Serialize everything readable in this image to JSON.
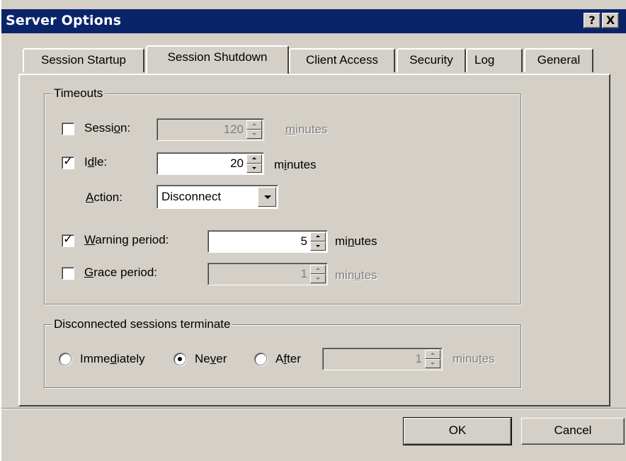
{
  "window": {
    "title": "Server Options",
    "help_label": "?",
    "close_label": "X"
  },
  "tabs": [
    {
      "label": "Session Startup"
    },
    {
      "label": "Session Shutdown",
      "active": true
    },
    {
      "label": "Client Access"
    },
    {
      "label": "Security"
    },
    {
      "label": "Log"
    },
    {
      "label": "General"
    }
  ],
  "timeouts": {
    "legend": "Timeouts",
    "session": {
      "label_pre": "Sessi",
      "label_ul": "o",
      "label_post": "n:",
      "checked": false,
      "value": "120",
      "unit_pre": "",
      "unit_ul": "m",
      "unit_post": "inutes",
      "enabled": false
    },
    "idle": {
      "label_pre": "I",
      "label_ul": "d",
      "label_post": "le:",
      "checked": true,
      "value": "20",
      "unit_pre": "m",
      "unit_ul": "i",
      "unit_post": "nutes",
      "enabled": true
    },
    "action": {
      "label_pre": "",
      "label_ul": "A",
      "label_post": "ction:",
      "value": "Disconnect"
    },
    "warning": {
      "label_pre": "",
      "label_ul": "W",
      "label_post": "arning period:",
      "checked": true,
      "value": "5",
      "unit_pre": "mi",
      "unit_ul": "n",
      "unit_post": "utes",
      "enabled": true
    },
    "grace": {
      "label_pre": "",
      "label_ul": "G",
      "label_post": "race period:",
      "checked": false,
      "value": "1",
      "unit_pre": "min",
      "unit_ul": "u",
      "unit_post": "tes",
      "enabled": false
    }
  },
  "disconnected": {
    "legend": "Disconnected sessions terminate",
    "immediately": {
      "label_pre": "Imme",
      "label_ul": "d",
      "label_post": "iately",
      "selected": false
    },
    "never": {
      "label_pre": "Ne",
      "label_ul": "v",
      "label_post": "er",
      "selected": true
    },
    "after": {
      "label_pre": "A",
      "label_ul": "f",
      "label_post": "ter",
      "selected": false,
      "value": "1",
      "unit_pre": "minu",
      "unit_ul": "t",
      "unit_post": "es"
    }
  },
  "buttons": {
    "ok": "OK",
    "cancel": "Cancel"
  },
  "colors": {
    "titlebar": "#0a246a",
    "face": "#d4d0c8",
    "disabled_text": "#808080"
  }
}
